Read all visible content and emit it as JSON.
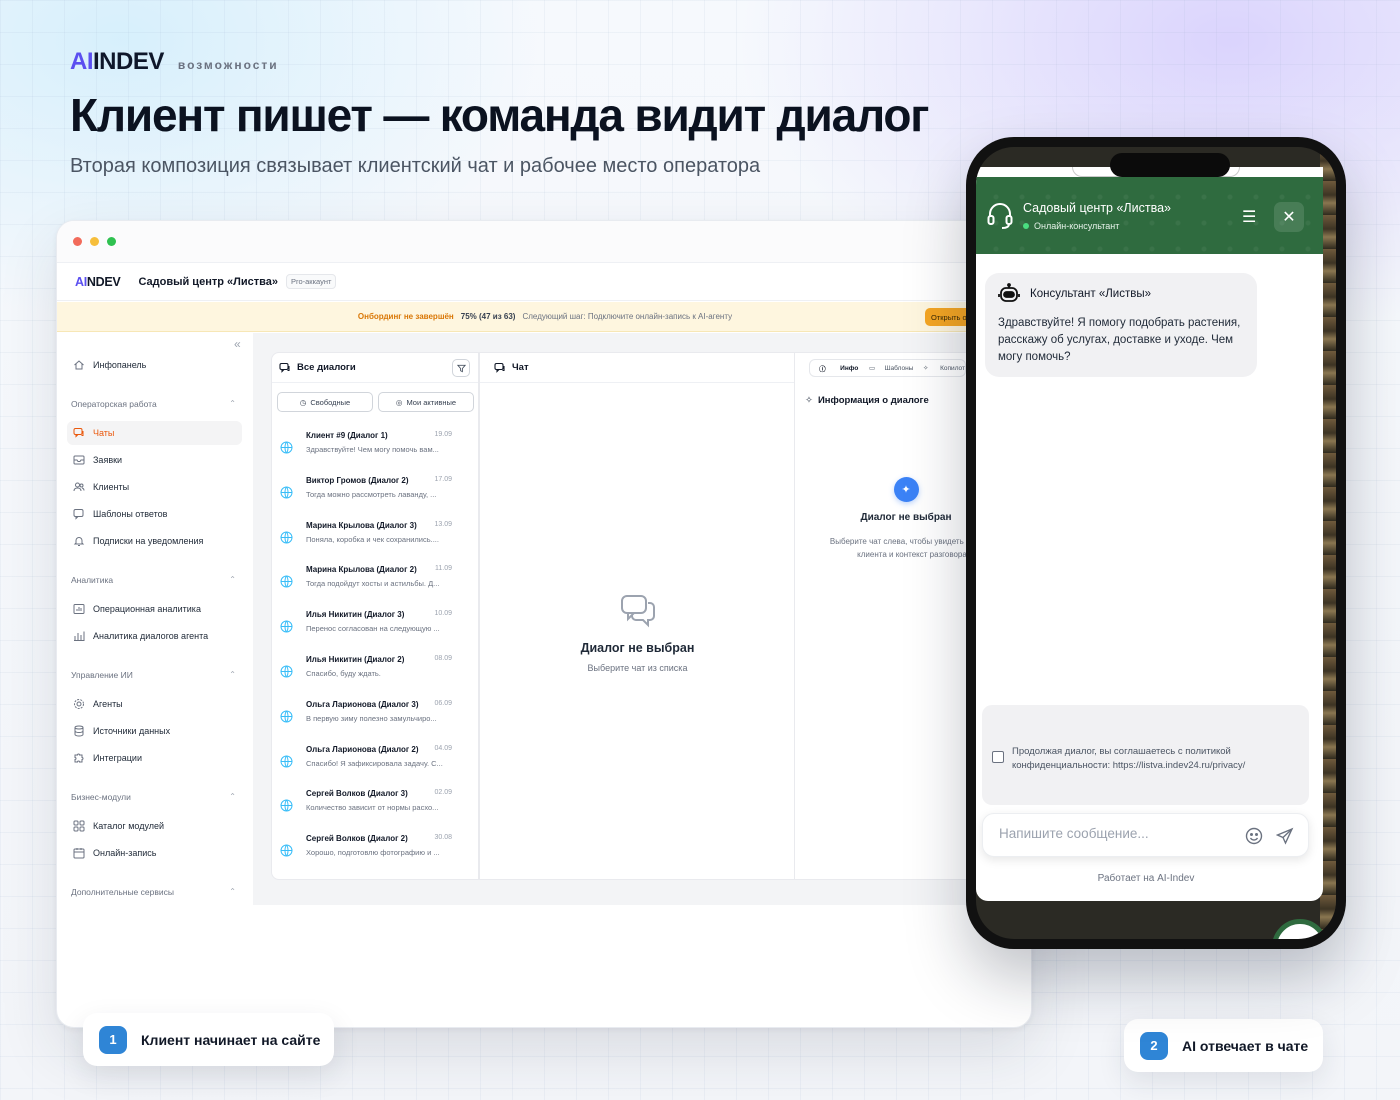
{
  "hero": {
    "brand_ai": "AI",
    "brand_rest": "INDEV",
    "brand_sub": "возможности",
    "title": "Клиент пишет — команда видит диалог",
    "subtitle": "Вторая композиция связывает клиентский чат и рабочее место оператора"
  },
  "app": {
    "logo_ai": "AI",
    "logo_rest": "NDEV",
    "org": "Садовый центр «Листва»",
    "plan": "Pro-аккаунт",
    "onboarding": {
      "warning": "Онбординг не завершён",
      "progress": "75% (47 из 63)",
      "next_step": "Следующий шаг: Подключите онлайн-запись к AI-агенту",
      "button": "Открыть онбординг"
    },
    "sidebar": {
      "collapse": "«",
      "top_item": {
        "label": "Инфопанель",
        "icon": "home-icon"
      },
      "sections": [
        {
          "title": "Операторская работа",
          "items": [
            {
              "label": "Чаты",
              "icon": "chat-icon",
              "active": true
            },
            {
              "label": "Заявки",
              "icon": "inbox-icon"
            },
            {
              "label": "Клиенты",
              "icon": "users-icon"
            },
            {
              "label": "Шаблоны ответов",
              "icon": "template-icon"
            },
            {
              "label": "Подписки на уведомления",
              "icon": "bell-icon"
            }
          ]
        },
        {
          "title": "Аналитика",
          "items": [
            {
              "label": "Операционная аналитика",
              "icon": "chart-icon"
            },
            {
              "label": "Аналитика диалогов агента",
              "icon": "bar-chart-icon"
            }
          ]
        },
        {
          "title": "Управление ИИ",
          "items": [
            {
              "label": "Агенты",
              "icon": "gear-icon"
            },
            {
              "label": "Источники данных",
              "icon": "database-icon"
            },
            {
              "label": "Интеграции",
              "icon": "puzzle-icon"
            }
          ]
        },
        {
          "title": "Бизнес-модули",
          "items": [
            {
              "label": "Каталог модулей",
              "icon": "grid-icon"
            },
            {
              "label": "Онлайн-запись",
              "icon": "calendar-icon"
            }
          ]
        },
        {
          "title": "Дополнительные сервисы",
          "items": []
        }
      ]
    },
    "dialogs": {
      "title": "Все диалоги",
      "seg_free": "Свободные",
      "seg_mine": "Мои активные",
      "items": [
        {
          "name": "Клиент #9 (Диалог 1)",
          "date": "19.09",
          "preview": "Здравствуйте! Чем могу помочь вам..."
        },
        {
          "name": "Виктор Громов (Диалог 2)",
          "date": "17.09",
          "preview": "Тогда можно рассмотреть лаванду, ..."
        },
        {
          "name": "Марина Крылова (Диалог 3)",
          "date": "13.09",
          "preview": "Поняла, коробка и чек сохранились...."
        },
        {
          "name": "Марина Крылова (Диалог 2)",
          "date": "11.09",
          "preview": "Тогда подойдут хосты и астильбы. Д..."
        },
        {
          "name": "Илья Никитин (Диалог 3)",
          "date": "10.09",
          "preview": "Перенос согласован на следующую ..."
        },
        {
          "name": "Илья Никитин (Диалог 2)",
          "date": "08.09",
          "preview": "Спасибо, буду ждать."
        },
        {
          "name": "Ольга Ларионова (Диалог 3)",
          "date": "06.09",
          "preview": "В первую зиму полезно замульчиро..."
        },
        {
          "name": "Ольга Ларионова (Диалог 2)",
          "date": "04.09",
          "preview": "Спасибо! Я зафиксировала задачу. С..."
        },
        {
          "name": "Сергей Волков (Диалог 3)",
          "date": "02.09",
          "preview": "Количество зависит от нормы расхо..."
        },
        {
          "name": "Сергей Волков (Диалог 2)",
          "date": "30.08",
          "preview": "Хорошо, подготовлю фотографию и ..."
        }
      ]
    },
    "chat": {
      "title": "Чат",
      "empty_title": "Диалог не выбран",
      "empty_sub": "Выберите чат из списка"
    },
    "info": {
      "tab_info": "Инфо",
      "tab_templates": "Шаблоны",
      "tab_copilot": "Копилот",
      "title": "Информация о диалоге",
      "empty_title": "Диалог не выбран",
      "empty_line1": "Выберите чат слева, чтобы увидеть данные",
      "empty_line2": "клиента и контекст разговора"
    }
  },
  "steps": [
    {
      "num": "1",
      "label": "Клиент начинает на сайте"
    },
    {
      "num": "2",
      "label": "AI отвечает в чате"
    }
  ],
  "widget": {
    "org": "Садовый центр «Листва»",
    "role": "Онлайн-консультант",
    "menu_icon": "menu-icon",
    "close_icon": "close-icon",
    "bot_name": "Консультант «Листвы»",
    "greeting": "Здравствуйте! Я помогу подобрать растения, расскажу об услугах, доставке и уходе. Чем могу помочь?",
    "consent": "Продолжая диалог, вы соглашаетесь с политикой конфиденциальности: https://listva.indev24.ru/privacy/",
    "input_placeholder": "Напишите сообщение...",
    "powered": "Работает на AI-Indev",
    "launcher_dots": "•••"
  },
  "colors": {
    "accent": "#5b4ff0",
    "orange": "#ea580c",
    "widget_green": "#2f6b3f",
    "step_blue": "#2f85d6"
  }
}
